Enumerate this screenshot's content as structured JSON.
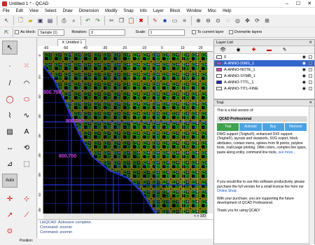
{
  "window": {
    "title": "Untitled 1 * - QCAD"
  },
  "menu": [
    "File",
    "Edit",
    "View",
    "Select",
    "Draw",
    "Dimension",
    "Modify",
    "Snap",
    "Info",
    "Layer",
    "Block",
    "Window",
    "Misc",
    "Help"
  ],
  "options_toolbar": {
    "as_block_label": "As block:",
    "block_name": "Sample (1)",
    "rotation_label": "Rotation:",
    "rotation_value": "0",
    "scale_label": "Scale:",
    "scale_value": "1",
    "to_current_layer": "To current layer",
    "overwrite_layers": "Overwrite layers"
  },
  "document_tab": "Untitled 1",
  "ruler": {
    "top": [
      "-60",
      "-50",
      "-40",
      "-30",
      "-20",
      "-10",
      "0",
      "10",
      "20"
    ],
    "left": [
      "0",
      "-10",
      "-20",
      "-30",
      "-40",
      "-50",
      "-60",
      "-70",
      "-80"
    ]
  },
  "drawing_labels": [
    "800.700",
    "800.700",
    "800.700"
  ],
  "scroll_indicator": "< > 100",
  "command_history": [
    "Command: zoomin",
    "Command: zoomin",
    "LibQCAD: Autosave complete."
  ],
  "status": {
    "position_label": "Position:"
  },
  "left_toolbar_mode": "Auto",
  "layer_list": {
    "title": "Layer List",
    "layers": [
      {
        "name": "0",
        "color": "#ffffff",
        "selected": false
      },
      {
        "name": "A-ANNO-DIMS_1",
        "color": "#9b59d0",
        "selected": true
      },
      {
        "name": "A-ANNO-NOTE_1",
        "color": "#e040c0",
        "selected": false
      },
      {
        "name": "A-ANNO-SYMB_1",
        "color": "#ffffff",
        "selected": false
      },
      {
        "name": "A-ANNO-TTTL_1",
        "color": "#2020c0",
        "selected": false
      },
      {
        "name": "A-ANNO-TITL-FINE",
        "color": "#ffffff",
        "selected": false
      }
    ]
  },
  "trial": {
    "title": "Trial",
    "intro": "This is a trial version of:",
    "product": "QCAD Professional",
    "tabs": [
      "Trial",
      "Activate",
      "Buy",
      "Remove"
    ],
    "features": "DWG support (Teigha®), enhanced DXF support (Teigha®), layouts and viewports, SVG export, block attributes, contact menu, splines from fit points, polyline tools, multi page printing, 24bit colors, complex line types, paste along entity, command line tools,",
    "see_more": "see more...",
    "purchase": "If you would like to use this software productively, please purchase the full version for a small license fee from our",
    "shop_link": "Online Shop.",
    "support": "With your purchase, you are supporting the future development of QCAD Professional.",
    "thanks": "Thank you for using QCAD!"
  },
  "colors": {
    "accent": "#3366cc",
    "trial_tab": "#4ba3e3",
    "trial_active": "#3fa34d"
  }
}
